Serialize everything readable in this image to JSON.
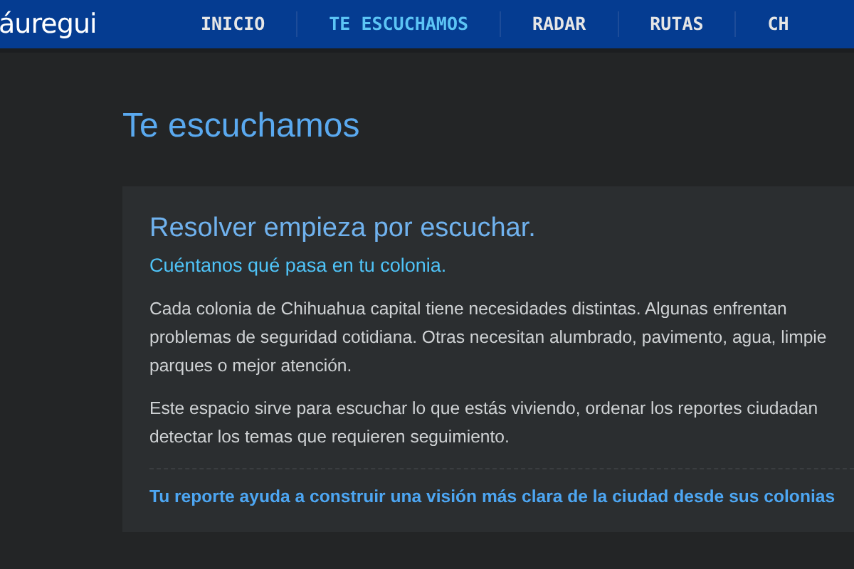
{
  "header": {
    "logo": "áuregui",
    "nav": [
      {
        "label": "INICIO",
        "selected": false
      },
      {
        "label": "TE ESCUCHAMOS",
        "selected": true
      },
      {
        "label": "RADAR",
        "selected": false
      },
      {
        "label": "RUTAS",
        "selected": false
      },
      {
        "label": "CH",
        "selected": false
      }
    ]
  },
  "page_title": "Te escuchamos",
  "card": {
    "title": "Resolver empieza por escuchar.",
    "subtitle": "Cuéntanos qué pasa en tu colonia.",
    "paragraphs": [
      [
        "Cada colonia de Chihuahua capital tiene necesidades distintas. Algunas enfrentan",
        "problemas de seguridad cotidiana. Otras necesitan alumbrado, pavimento, agua, limpie",
        "parques o mejor atención."
      ],
      [
        "Este espacio sirve para escuchar lo que estás viviendo, ordenar los reportes ciudadan",
        "detectar los temas que requieren seguimiento."
      ]
    ],
    "footer": "Tu reporte ayuda a construir una visión más clara de la ciudad desde sus colonias"
  }
}
